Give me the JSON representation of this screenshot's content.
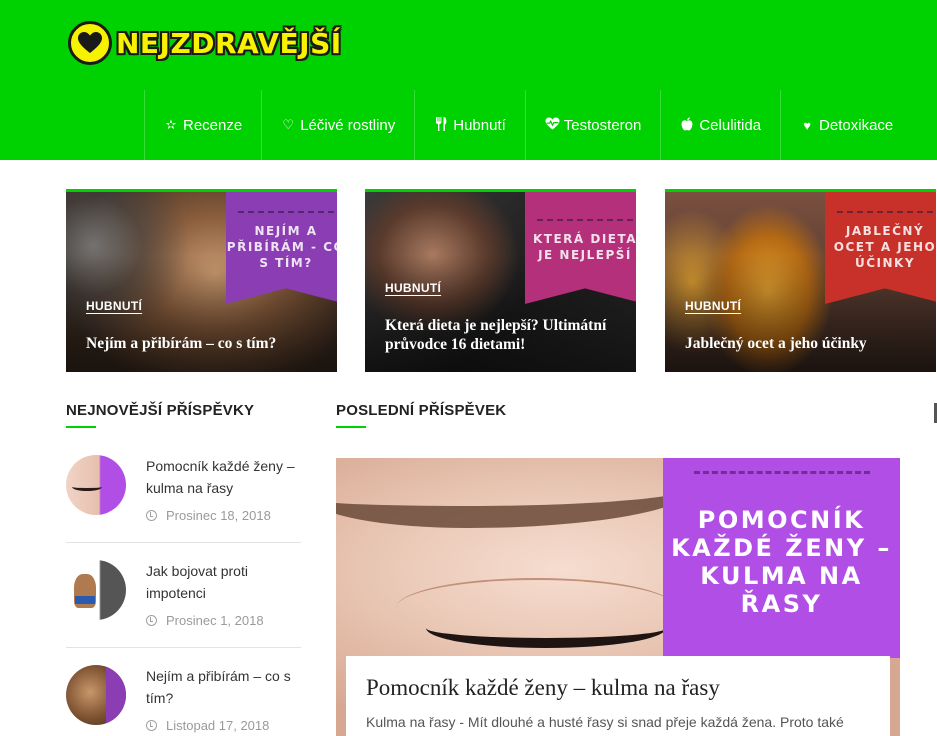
{
  "brand": {
    "name": "NEJZDRAVĚJŠÍ",
    "logo_icon": "heart-icon",
    "header_color": "#00d100",
    "logo_yellow": "#f6f200"
  },
  "nav": [
    {
      "label": "Recenze",
      "icon": "star-icon"
    },
    {
      "label": "Léčivé rostliny",
      "icon": "heart-outline-icon"
    },
    {
      "label": "Hubnutí",
      "icon": "cutlery-icon"
    },
    {
      "label": "Testosteron",
      "icon": "heartbeat-icon"
    },
    {
      "label": "Celulitida",
      "icon": "apple-icon"
    },
    {
      "label": "Detoxikace",
      "icon": "heart-icon"
    }
  ],
  "featured": [
    {
      "category": "HUBNUTÍ",
      "title": "Nejím a přibírám – co s tím?",
      "banner_text": "NEJÍM A PŘIBÍRÁM - CO S TÍM?"
    },
    {
      "category": "HUBNUTÍ",
      "title": "Která dieta je nejlepší? Ultimátní průvodce 16 dietami!",
      "banner_text": "KTERÁ DIETA JE NEJLEPŠÍ"
    },
    {
      "category": "HUBNUTÍ",
      "title": "Jablečný ocet a jeho účinky",
      "banner_text": "JABLEČNÝ OCET A JEHO ÚČINKY"
    }
  ],
  "sidebar": {
    "heading": "NEJNOVĚJŠÍ PŘÍSPĚVKY",
    "items": [
      {
        "title": "Pomocník každé ženy – kulma na řasy",
        "date": "Prosinec 18, 2018"
      },
      {
        "title": "Jak bojovat proti impotenci",
        "date": "Prosinec 1, 2018"
      },
      {
        "title": "Nejím a přibírám – co s tím?",
        "date": "Listopad 17, 2018"
      }
    ]
  },
  "main": {
    "heading": "POSLEDNÍ PŘÍSPĚVEK",
    "post": {
      "banner_text": "POMOCNÍK KAŽDÉ ŽENY – KULMA NA ŘASY",
      "title": "Pomocník každé ženy – kulma na řasy",
      "excerpt": "Kulma na řasy - Mít dlouhé a husté řasy si snad přeje každá žena. Proto také"
    }
  }
}
